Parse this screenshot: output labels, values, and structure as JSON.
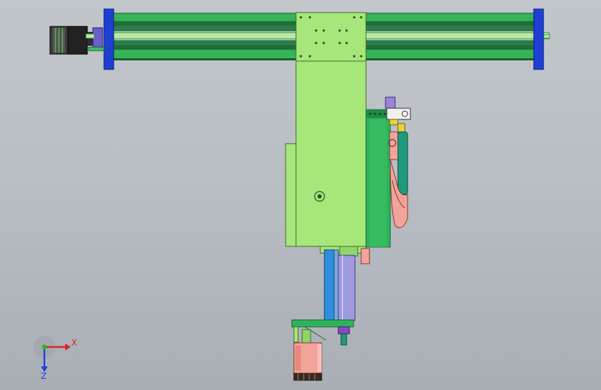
{
  "viewport": {
    "background_top": "#c2c7cc",
    "background_bottom": "#a9aeb5"
  },
  "colors": {
    "rail_green": "#3fbf63",
    "plate_green": "#a6e67a",
    "end_plate_blue": "#1f3fd4",
    "motor_dark": "#2a2a2a",
    "cylinder_blue": "#2f8ee0",
    "rod_lavender": "#9f9be0",
    "salmon": "#f2a39a",
    "purple_accent": "#8a48c8"
  },
  "triad": {
    "x_label": "X",
    "z_label": "Z",
    "x_color": "#e02020",
    "z_color": "#2040e0",
    "y_color": "#20c020"
  },
  "icons": [
    "axis-triad-icon"
  ]
}
